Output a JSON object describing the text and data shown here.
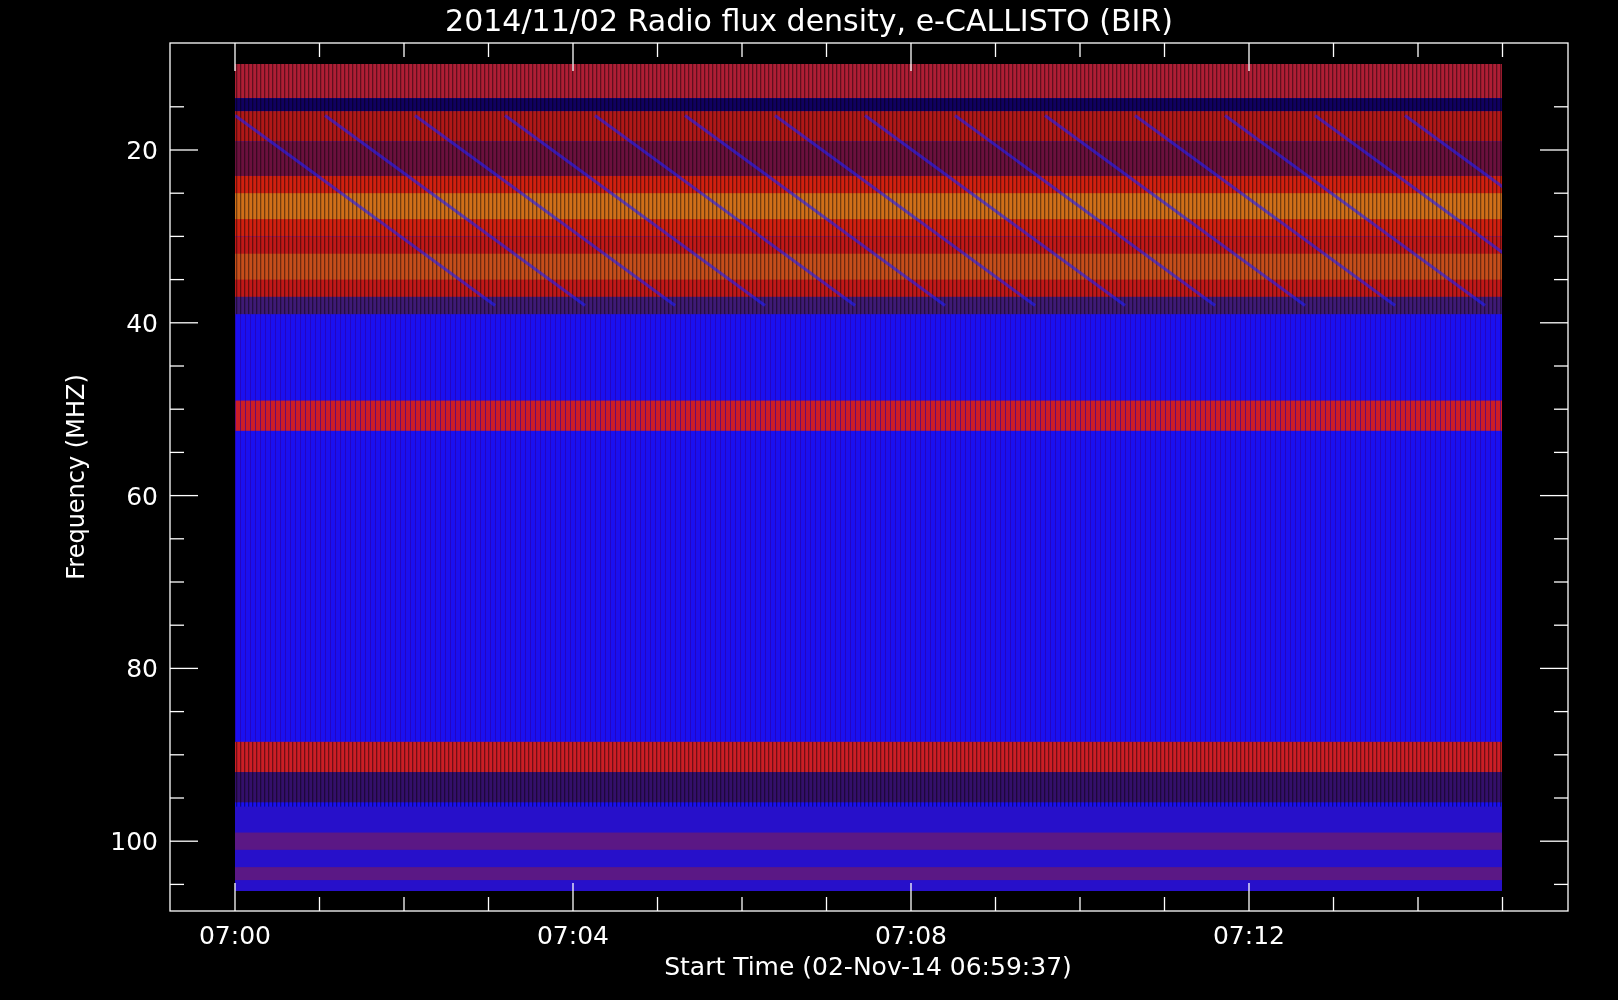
{
  "title": "2014/11/02  Radio flux density, e-CALLISTO (BIR)",
  "ylabel": "Frequency (MHZ)",
  "xlabel": "Start Time (02-Nov-14 06:59:37)",
  "yticks": [
    "20",
    "40",
    "60",
    "80",
    "100"
  ],
  "xticks": [
    "07:00",
    "07:04",
    "07:08",
    "07:12"
  ]
}
